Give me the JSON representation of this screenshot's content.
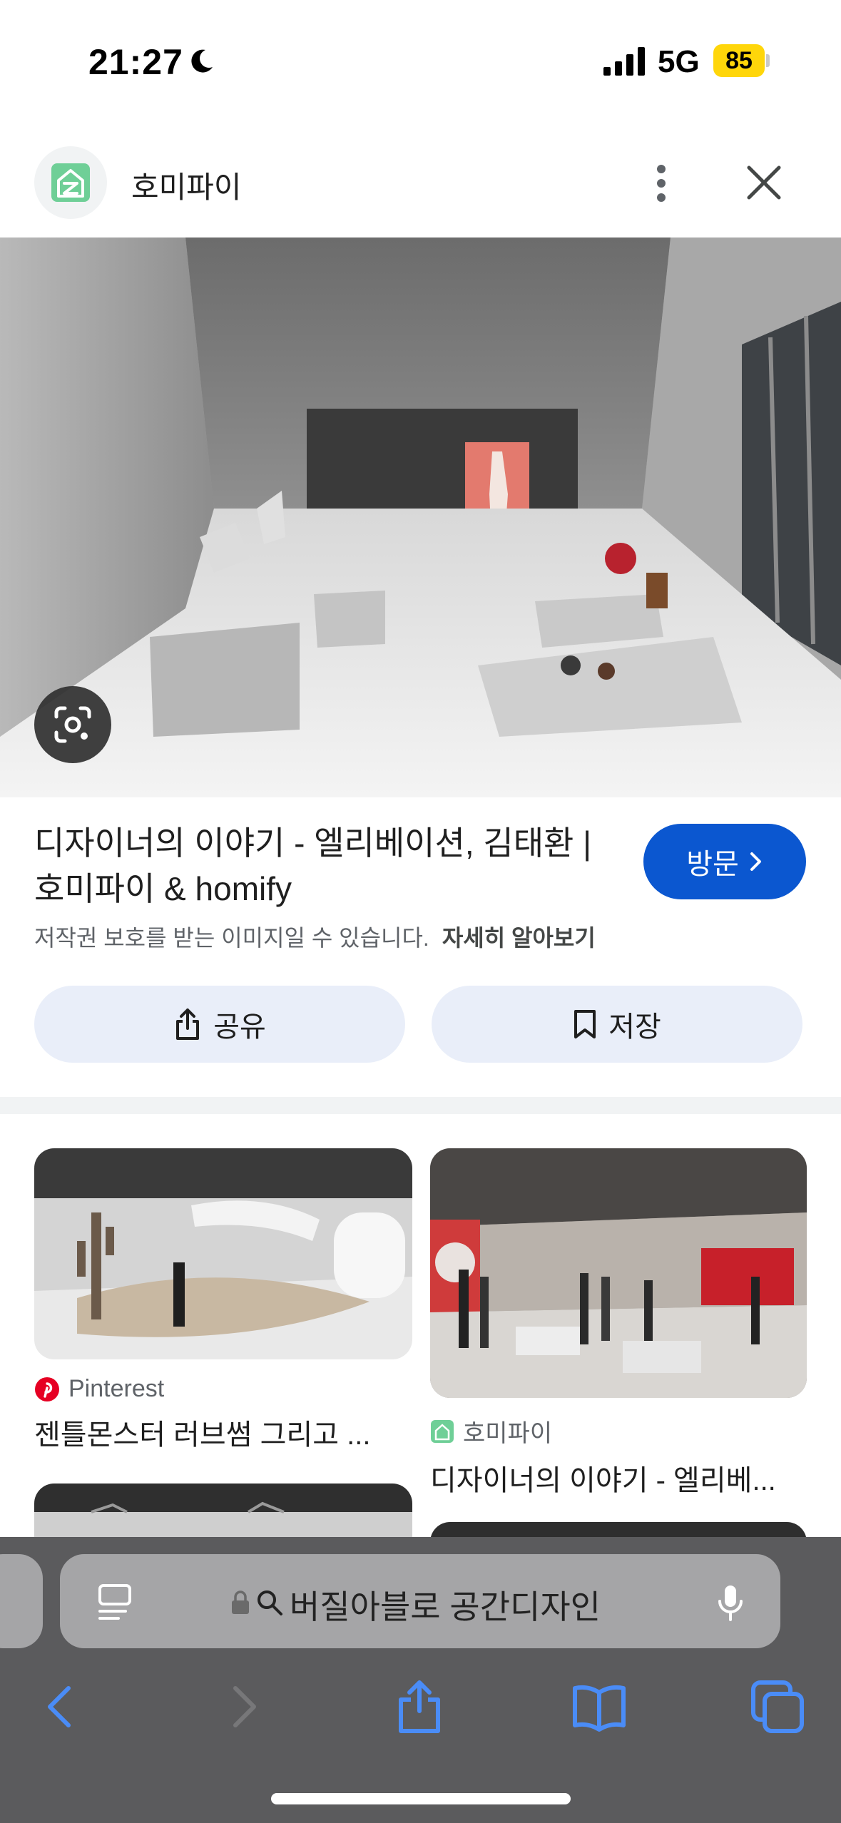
{
  "status_bar": {
    "time": "21:27",
    "network": "5G",
    "battery": "85"
  },
  "viewer": {
    "site_name": "호미파이",
    "title": "디자이너의 이야기 - 엘리베이션, 김태환 | 호미파이 & homify",
    "visit_label": "방문",
    "copyright_notice": "저작권 보호를 받는 이미지일 수 있습니다.",
    "learn_more": "자세히 알아보기",
    "share_label": "공유",
    "save_label": "저장"
  },
  "results": [
    {
      "source": "Pinterest",
      "title": "젠틀몬스터 러브썸 그리고 ...",
      "source_color": "#e60023"
    },
    {
      "source": "호미파이",
      "title": "디자이너의 이야기 - 엘리베...",
      "source_color": "#34a853"
    }
  ],
  "safari": {
    "search_text": "버질아블로 공간디자인"
  },
  "colors": {
    "accent": "#0b57d0",
    "action_bg": "#e9eef9",
    "safari_bg": "#5b5b5d",
    "safari_icon": "#4a8cf7"
  }
}
